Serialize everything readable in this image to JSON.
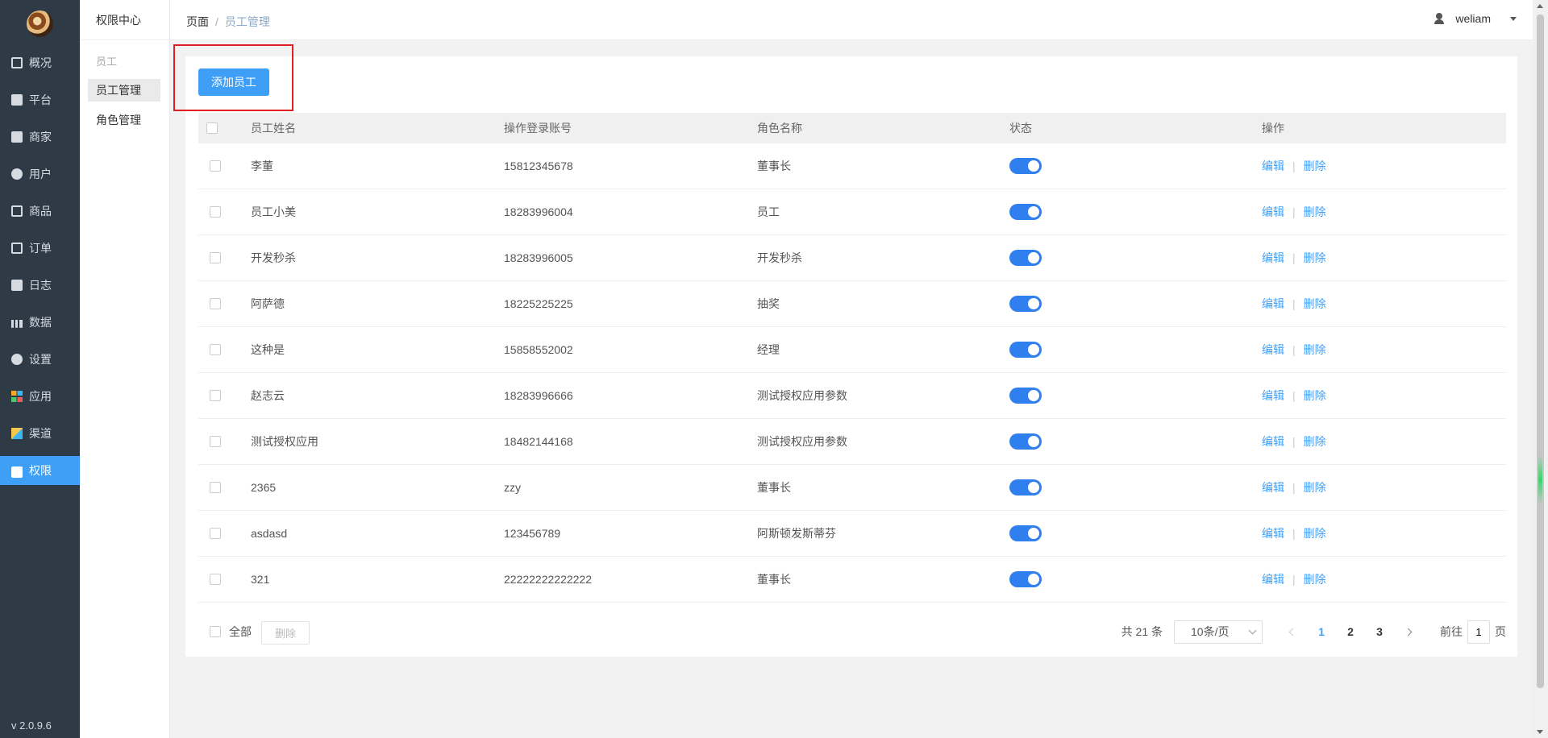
{
  "nav": {
    "items": [
      {
        "label": "概况",
        "icon": "dashboard-icon"
      },
      {
        "label": "平台",
        "icon": "monitor-icon"
      },
      {
        "label": "商家",
        "icon": "shop-icon"
      },
      {
        "label": "用户",
        "icon": "user-icon"
      },
      {
        "label": "商品",
        "icon": "goods-icon"
      },
      {
        "label": "订单",
        "icon": "order-icon"
      },
      {
        "label": "日志",
        "icon": "log-icon"
      },
      {
        "label": "数据",
        "icon": "chart-icon"
      },
      {
        "label": "设置",
        "icon": "gear-icon"
      },
      {
        "label": "应用",
        "icon": "apps-icon"
      },
      {
        "label": "渠道",
        "icon": "cube-icon"
      },
      {
        "label": "权限",
        "icon": "lock-icon"
      }
    ],
    "active_label": "权限",
    "version": "v 2.0.9.6"
  },
  "subnav": {
    "title": "权限中心",
    "group": "员工",
    "items": [
      "员工管理",
      "角色管理"
    ],
    "active": "员工管理"
  },
  "breadcrumb": {
    "root": "页面",
    "sep": "/",
    "current": "员工管理"
  },
  "user": {
    "name": "weliam"
  },
  "toolbar": {
    "add_label": "添加员工"
  },
  "table": {
    "headers": [
      "员工姓名",
      "操作登录账号",
      "角色名称",
      "状态",
      "操作"
    ],
    "rows": [
      {
        "name": "李董",
        "account": "15812345678",
        "role": "董事长",
        "enabled": true
      },
      {
        "name": "员工小美",
        "account": "18283996004",
        "role": "员工",
        "enabled": true
      },
      {
        "name": "开发秒杀",
        "account": "18283996005",
        "role": "开发秒杀",
        "enabled": true
      },
      {
        "name": "阿萨德",
        "account": "18225225225",
        "role": "抽奖",
        "enabled": true
      },
      {
        "name": "这种是",
        "account": "15858552002",
        "role": "经理",
        "enabled": true
      },
      {
        "name": "赵志云",
        "account": "18283996666",
        "role": "测试授权应用参数",
        "enabled": true
      },
      {
        "name": "测试授权应用",
        "account": "18482144168",
        "role": "测试授权应用参数",
        "enabled": true
      },
      {
        "name": "2365",
        "account": "zzy",
        "role": "董事长",
        "enabled": true
      },
      {
        "name": "asdasd",
        "account": "123456789",
        "role": "阿斯顿发斯蒂芬",
        "enabled": true
      },
      {
        "name": "321",
        "account": "22222222222222",
        "role": "董事长",
        "enabled": true
      }
    ],
    "edit_label": "编辑",
    "delete_label": "删除",
    "action_sep": "|"
  },
  "footer": {
    "select_all_label": "全部",
    "batch_delete_label": "删除",
    "total_text": "共 21 条",
    "page_size": "10条/页",
    "pages": [
      "1",
      "2",
      "3"
    ],
    "current_page": "1",
    "goto_prefix": "前往",
    "goto_value": "1",
    "goto_suffix": "页"
  },
  "colors": {
    "accent": "#3f9ff6",
    "nav_bg": "#2f3a47",
    "switch_on": "#2f7fee",
    "highlight": "#e02020"
  }
}
